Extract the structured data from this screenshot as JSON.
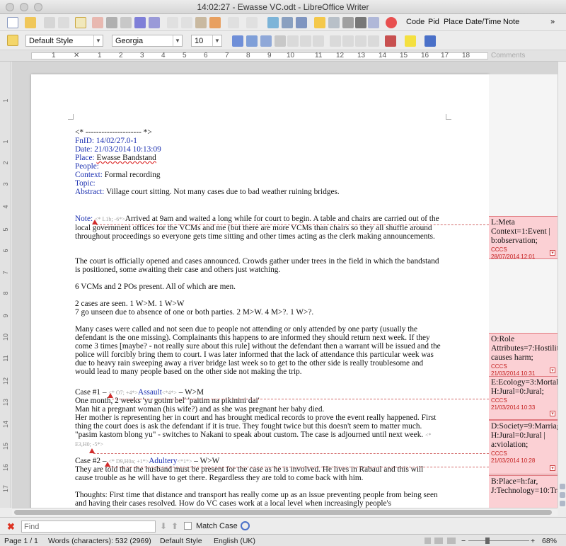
{
  "window": {
    "title": "14:02:27 - Ewasse VC.odt - LibreOffice Writer"
  },
  "toolbar": {
    "menu_items": [
      "Code",
      "Pid",
      "Place",
      "Date/Time",
      "Note"
    ],
    "overflow": "»"
  },
  "format_bar": {
    "paragraph_style": "Default Style",
    "font_name": "Georgia",
    "font_size": "10"
  },
  "ruler": {
    "numbers": [
      "1",
      "1",
      "2",
      "3",
      "4",
      "5",
      "6",
      "7",
      "8",
      "9",
      "10",
      "11",
      "12",
      "13",
      "14",
      "15",
      "16",
      "17",
      "18"
    ],
    "comments_label": "Comments"
  },
  "vruler": {
    "numbers": [
      "1",
      "1",
      "2",
      "3",
      "4",
      "5",
      "6",
      "7",
      "8",
      "9",
      "10",
      "11",
      "12",
      "13",
      "14",
      "15",
      "16",
      "17"
    ]
  },
  "document": {
    "separator": "<* --------------------- *>",
    "fnid": "FnID: 14/02/27.0-1",
    "date": "Date: 21/03/2014 10:13:09",
    "place_label": "Place:",
    "place_value": "Ewasse Bandstand",
    "people_label": "People:",
    "context_label": "Context:",
    "context_value": "Formal recording",
    "topic_label": "Topic:",
    "abstract_label": "Abstract:",
    "abstract_value": "Village court sitting. Not many cases due to bad weather ruining bridges.",
    "note_label": "Note:",
    "note_tag": "<* L1b; -6*>",
    "note_text": "Arrived at 9am and waited a long while for court to begin. A table and chairs are carried out of the local government offices for the VCMs and me (but there are more VCMs than chairs so they all shuffle around throughout proceedings so everyone gets time sitting and other times acting as the clerk making announcements.",
    "p2": "The court is officially opened and cases announced. Crowds gather under trees in the field in which the bandstand is positioned, some awaiting their case and others just watching.",
    "p3": "6 VCMs and 2 POs present. All of which are men.",
    "p4a": "2 cases are seen. 1 W>M. 1 W>W",
    "p4b": "7 go unseen due to absence of one or both parties. 2 M>W. 4 M>?. 1 W>?.",
    "p5": "Many cases were called and not seen due to people not attending or only attended by one party (usually the defendant is the one missing). Complainants this happens to are informed they should return next week. If they come 3 times [maybe? - not really sure about this rule] without the defendant then a warrant will be issued and the police will forcibly bring them to court. I was later informed that the lack of attendance this particular week was due to heavy rain sweeping away a river bridge last week so to get to the other side is really troublesome and would lead to many people based on the other side not making the trip.",
    "case1_prefix": "Case #1 –",
    "case1_tag": "<* O7; +4*>",
    "case1_name": "Assault",
    "case1_tag2": "<*4*>",
    "case1_suffix": "– W>M",
    "case1_l1": "One month, 2 weeks 'yu gotim bel' 'paitim na pikinini dai'",
    "case1_l2": "Man hit a pregnant woman (his wife?) and as she was pregnant her baby died.",
    "case1_l3": "Her mother is representing her in court and has brought medical records to prove the event really happened. First thing the court does is ask the defendant if it is true. They fought twice but this doesn't seem to matter much. \"pasim kastom blong yu\" - switches to Nakani to speak about custom. The case is adjourned until next week.",
    "case1_tag3": "<* E3,H0; -5*>",
    "case2_prefix": "Case #2 –",
    "case2_tag": "<* D9,H0a; +1*>",
    "case2_name": "Adultery",
    "case2_tag2": "<*1*>",
    "case2_suffix": "– W>W",
    "case2_text": "They are told that the husband must be present for the case as he is involved. He lives in Rabaul and this will cause trouble as he will have to get there. Regardless they are told to come back with him.",
    "thoughts": "Thoughts: First time that distance and transport has really come up as an issue preventing people from being seen and having their cases resolved. How do VC cases work at a local level when increasingly people's"
  },
  "comments": [
    {
      "text": "L:Meta Context=1:Event | b:observation;",
      "author": "CCCS",
      "date": "28/07/2014 12:01"
    },
    {
      "text": "O:Role Attributes=7:Hostility causes harm;",
      "author": "CCCS",
      "date": "21/03/2014 10:31"
    },
    {
      "text": "E:Ecology=3:Mortality, H:Jural=0:Jural;",
      "author": "CCCS",
      "date": "21/03/2014 10:33"
    },
    {
      "text": "D:Society=9:Marriage, H:Jural=0:Jural | a:violation;",
      "author": "CCCS",
      "date": "21/03/2014 10:28"
    },
    {
      "text": "B:Place=h:far, J:Technology=10:Transportation;",
      "author": "",
      "date": ""
    }
  ],
  "findbar": {
    "placeholder": "Find",
    "match_case": "Match Case"
  },
  "statusbar": {
    "page": "Page 1 / 1",
    "words": "Words (characters): 532 (2969)",
    "style": "Default Style",
    "language": "English (UK)",
    "zoom": "68%"
  },
  "colors": {
    "link_blue": "#1b2fb0",
    "comment_bg": "#fbd0d4",
    "comment_accent": "#d12b2b"
  }
}
